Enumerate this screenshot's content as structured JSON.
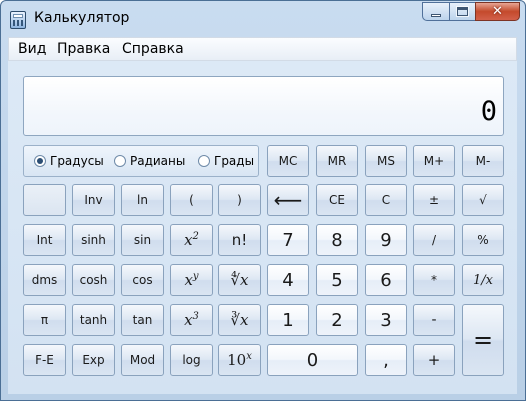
{
  "window": {
    "title": "Калькулятор"
  },
  "title_buttons": {
    "close": "✕"
  },
  "menu": [
    {
      "label": "Вид",
      "name": "menu-view"
    },
    {
      "label": "Правка",
      "name": "menu-edit"
    },
    {
      "label": "Справка",
      "name": "menu-help"
    }
  ],
  "display": {
    "value": "0"
  },
  "angle_modes": [
    {
      "label": "Градусы",
      "selected": true
    },
    {
      "label": "Радианы",
      "selected": false
    },
    {
      "label": "Грады",
      "selected": false
    }
  ],
  "memory": {
    "mc": "MC",
    "mr": "MR",
    "ms": "MS",
    "mplus": "M+",
    "mminus": "M-"
  },
  "sci": {
    "inv": "Inv",
    "ln": "ln",
    "lparen": "(",
    "rparen": ")",
    "int": "Int",
    "sinh": "sinh",
    "sin": "sin",
    "x2": "x",
    "x2_sup": "2",
    "fact": "n!",
    "dms": "dms",
    "cosh": "cosh",
    "cos": "cos",
    "xy": "x",
    "xy_sup": "y",
    "yroot": "∜x",
    "pi": "π",
    "tanh": "tanh",
    "tan": "tan",
    "x3": "x",
    "x3_sup": "3",
    "cbrt": "∛x",
    "fe": "F-E",
    "exp": "Exp",
    "mod": "Mod",
    "log": "log",
    "tenx": "10",
    "tenx_sup": "x"
  },
  "std": {
    "back": "⟵",
    "ce": "CE",
    "c": "C",
    "plusminus": "±",
    "sqrt": "√",
    "div": "/",
    "pct": "%",
    "mul": "*",
    "recip": "1/x",
    "sub": "-",
    "add": "+",
    "eq": "=",
    "dot": ","
  },
  "digits": {
    "d0": "0",
    "d1": "1",
    "d2": "2",
    "d3": "3",
    "d4": "4",
    "d5": "5",
    "d6": "6",
    "d7": "7",
    "d8": "8",
    "d9": "9"
  }
}
